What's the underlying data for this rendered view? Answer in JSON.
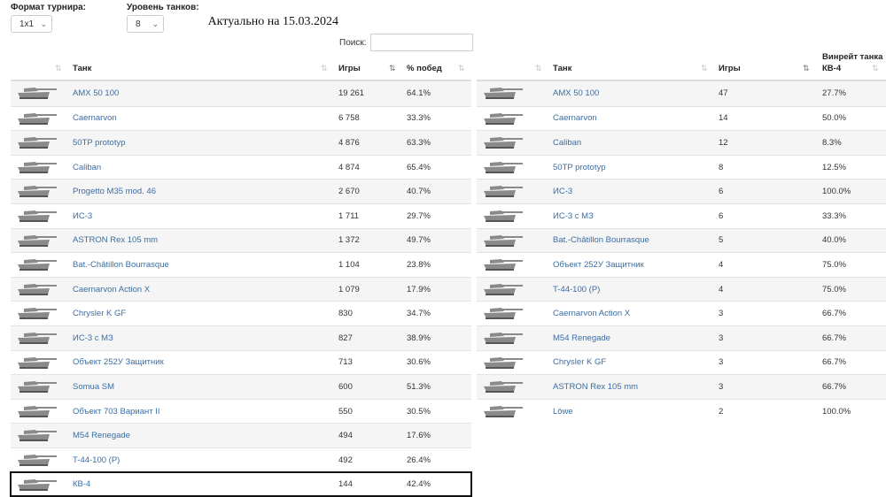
{
  "filters": {
    "format_label": "Формат турнира:",
    "format_value": "1x1",
    "level_label": "Уровень танков:",
    "level_value": "8",
    "actual_text": "Актуально на 15.03.2024"
  },
  "search": {
    "label": "Поиск:",
    "value": ""
  },
  "left_table": {
    "headers": {
      "tank": "Танк",
      "games": "Игры",
      "winrate": "% побед"
    },
    "rows": [
      {
        "tank": "AMX 50 100",
        "games": "19 261",
        "winrate": "64.1%"
      },
      {
        "tank": "Caernarvon",
        "games": "6 758",
        "winrate": "33.3%"
      },
      {
        "tank": "50TP prototyp",
        "games": "4 876",
        "winrate": "63.3%"
      },
      {
        "tank": "Caliban",
        "games": "4 874",
        "winrate": "65.4%"
      },
      {
        "tank": "Progetto M35 mod. 46",
        "games": "2 670",
        "winrate": "40.7%"
      },
      {
        "tank": "ИС-3",
        "games": "1 711",
        "winrate": "29.7%"
      },
      {
        "tank": "ASTRON Rex 105 mm",
        "games": "1 372",
        "winrate": "49.7%"
      },
      {
        "tank": "Bat.-Châtillon Bourrasque",
        "games": "1 104",
        "winrate": "23.8%"
      },
      {
        "tank": "Caernarvon Action X",
        "games": "1 079",
        "winrate": "17.9%"
      },
      {
        "tank": "Chrysler K GF",
        "games": "830",
        "winrate": "34.7%"
      },
      {
        "tank": "ИС-3 с МЗ",
        "games": "827",
        "winrate": "38.9%"
      },
      {
        "tank": "Объект 252У Защитник",
        "games": "713",
        "winrate": "30.6%"
      },
      {
        "tank": "Somua SM",
        "games": "600",
        "winrate": "51.3%"
      },
      {
        "tank": "Объект 703 Вариант II",
        "games": "550",
        "winrate": "30.5%"
      },
      {
        "tank": "M54 Renegade",
        "games": "494",
        "winrate": "17.6%"
      },
      {
        "tank": "T-44-100 (P)",
        "games": "492",
        "winrate": "26.4%"
      },
      {
        "tank": "КВ-4",
        "games": "144",
        "winrate": "42.4%"
      }
    ]
  },
  "right_table": {
    "headers": {
      "tank": "Танк",
      "games": "Игры",
      "winrate_line1": "Винрейт танка",
      "winrate_line2": "КВ-4"
    },
    "rows": [
      {
        "tank": "AMX 50 100",
        "games": "47",
        "winrate": "27.7%"
      },
      {
        "tank": "Caernarvon",
        "games": "14",
        "winrate": "50.0%"
      },
      {
        "tank": "Caliban",
        "games": "12",
        "winrate": "8.3%"
      },
      {
        "tank": "50TP prototyp",
        "games": "8",
        "winrate": "12.5%"
      },
      {
        "tank": "ИС-3",
        "games": "6",
        "winrate": "100.0%"
      },
      {
        "tank": "ИС-3 с МЗ",
        "games": "6",
        "winrate": "33.3%"
      },
      {
        "tank": "Bat.-Châtillon Bourrasque",
        "games": "5",
        "winrate": "40.0%"
      },
      {
        "tank": "Объект 252У Защитник",
        "games": "4",
        "winrate": "75.0%"
      },
      {
        "tank": "T-44-100 (P)",
        "games": "4",
        "winrate": "75.0%"
      },
      {
        "tank": "Caernarvon Action X",
        "games": "3",
        "winrate": "66.7%"
      },
      {
        "tank": "M54 Renegade",
        "games": "3",
        "winrate": "66.7%"
      },
      {
        "tank": "Chrysler K GF",
        "games": "3",
        "winrate": "66.7%"
      },
      {
        "tank": "ASTRON Rex 105 mm",
        "games": "3",
        "winrate": "66.7%"
      },
      {
        "tank": "Löwe",
        "games": "2",
        "winrate": "100.0%"
      }
    ]
  },
  "colors": {
    "link": "#3a6ea5",
    "stripe": "#f5f5f5",
    "tank_icon": "#8a8a8a"
  },
  "icons": {
    "sort": "sort-arrows-icon",
    "sort_active": "sort-desc-icon",
    "tank": "tank-silhouette-icon",
    "dropdown": "chevron-down-icon"
  }
}
